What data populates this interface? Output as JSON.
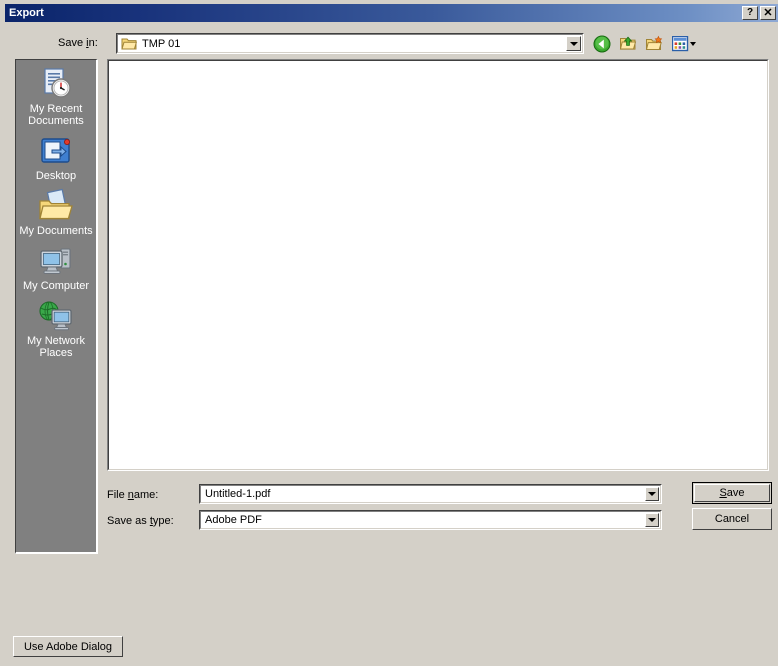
{
  "window": {
    "title": "Export",
    "help_button": "?",
    "close_button": "✕"
  },
  "toolbar": {
    "save_in_label_pre": "Save ",
    "save_in_label_acc": "i",
    "save_in_label_post": "n:",
    "save_in_value": "TMP 01",
    "buttons": [
      {
        "name": "back-button",
        "tooltip": "Back"
      },
      {
        "name": "up-one-level-button",
        "tooltip": "Up One Level"
      },
      {
        "name": "new-folder-button",
        "tooltip": "Create New Folder"
      },
      {
        "name": "views-button",
        "tooltip": "Views"
      }
    ]
  },
  "places": {
    "items": [
      {
        "label": "My Recent Documents",
        "icon": "recent-documents-icon"
      },
      {
        "label": "Desktop",
        "icon": "desktop-icon"
      },
      {
        "label": "My Documents",
        "icon": "my-documents-icon"
      },
      {
        "label": "My Computer",
        "icon": "my-computer-icon"
      },
      {
        "label": "My Network Places",
        "icon": "my-network-places-icon"
      }
    ]
  },
  "filelist": {
    "items": [],
    "empty": true
  },
  "fields": {
    "filename_label_pre": "File ",
    "filename_label_acc": "n",
    "filename_label_post": "ame:",
    "filename_value": "Untitled-1.pdf",
    "filetype_label_pre": "Save as ",
    "filetype_label_acc": "t",
    "filetype_label_post": "ype:",
    "filetype_value": "Adobe PDF",
    "filetype_options": [
      "Adobe PDF"
    ]
  },
  "buttons": {
    "save_pre": "",
    "save_acc": "S",
    "save_post": "ave",
    "cancel": "Cancel",
    "use_adobe_dialog": "Use Adobe Dialog"
  },
  "colors": {
    "face": "#d4d0c8",
    "title_left": "#0a246a",
    "title_right": "#8fa9d4",
    "placesbar": "#808080",
    "field_bg": "#ffffff"
  }
}
